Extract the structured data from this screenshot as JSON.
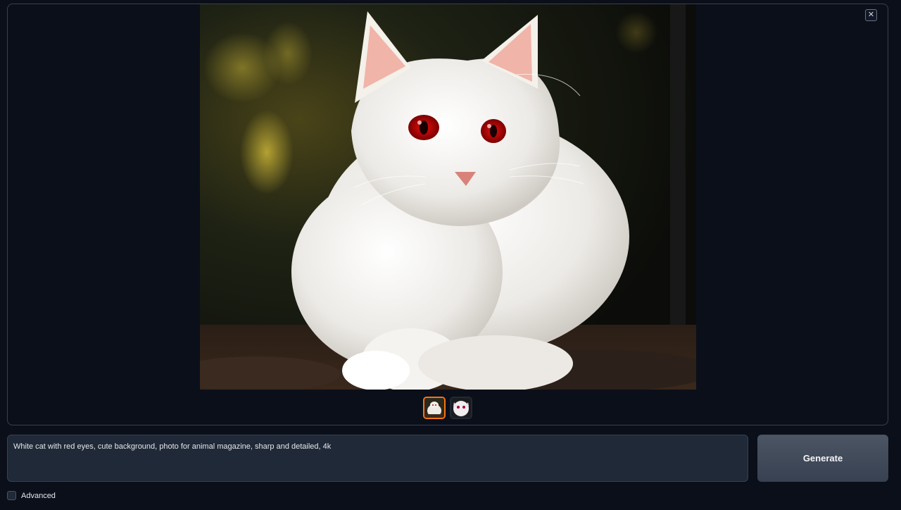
{
  "gallery": {
    "close_icon": "close-icon",
    "main_image_alt": "White cat with red eyes",
    "thumbnails": [
      {
        "selected": true
      },
      {
        "selected": false
      }
    ],
    "accent_color": "#f97316"
  },
  "prompt": {
    "value": "White cat with red eyes, cute background, photo for animal magazine, sharp and detailed, 4k"
  },
  "generate": {
    "label": "Generate"
  },
  "advanced": {
    "label": "Advanced",
    "checked": false
  }
}
